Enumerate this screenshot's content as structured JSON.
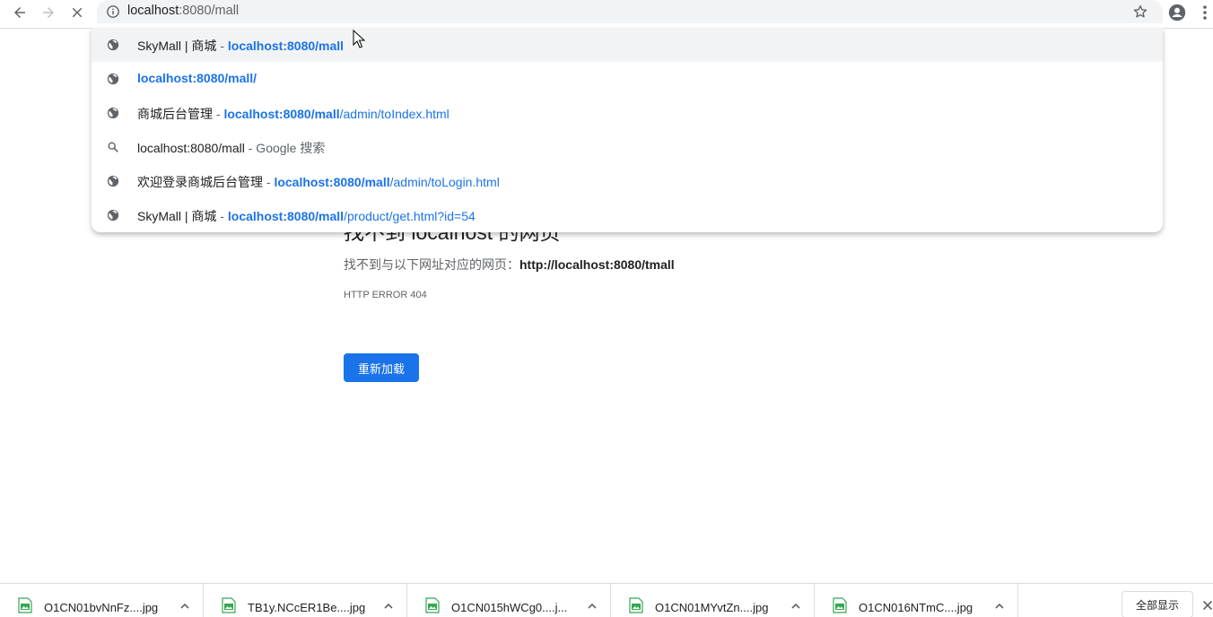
{
  "omnibox": {
    "url_host": "localhost",
    "url_rest": ":8080/mall"
  },
  "suggestions": [
    {
      "icon": "globe-icon",
      "title": "SkyMall | 商城",
      "sep": " - ",
      "url_bold": "localhost:8080/mall",
      "url_rest": "",
      "selected": true
    },
    {
      "icon": "globe-icon",
      "title": "",
      "sep": "",
      "url_bold": "localhost:8080/mall/",
      "url_rest": "",
      "selected": false
    },
    {
      "icon": "globe-icon",
      "title": "商城后台管理",
      "sep": " - ",
      "url_bold": "localhost:8080/mall",
      "url_rest": "/admin/toIndex.html",
      "selected": false
    },
    {
      "icon": "search-icon",
      "title": "localhost:8080/mall",
      "sep": " - Google 搜索",
      "url_bold": "",
      "url_rest": "",
      "selected": false
    },
    {
      "icon": "globe-icon",
      "title": "欢迎登录商城后台管理",
      "sep": " - ",
      "url_bold": "localhost:8080/mall",
      "url_rest": "/admin/toLogin.html",
      "selected": false
    },
    {
      "icon": "globe-icon",
      "title": "SkyMall | 商城",
      "sep": " - ",
      "url_bold": "localhost:8080/mall",
      "url_rest": "/product/get.html?id=54",
      "selected": false
    }
  ],
  "error_page": {
    "title": "找不到 localhost 的网页",
    "desc_prefix": "找不到与以下网址对应的网页：",
    "desc_url": "http://localhost:8080/tmall",
    "code": "HTTP ERROR 404",
    "reload_label": "重新加载"
  },
  "downloads": {
    "items": [
      {
        "name": "O1CN01bvNnFz....jpg"
      },
      {
        "name": "TB1y.NCcER1Be....jpg"
      },
      {
        "name": "O1CN015hWCg0....j..."
      },
      {
        "name": "O1CN01MYvtZn....jpg"
      },
      {
        "name": "O1CN016NTmC....jpg"
      }
    ],
    "show_all_label": "全部显示"
  },
  "colors": {
    "accent": "#1a73e8",
    "omnibox_bg": "#f1f3f4"
  }
}
